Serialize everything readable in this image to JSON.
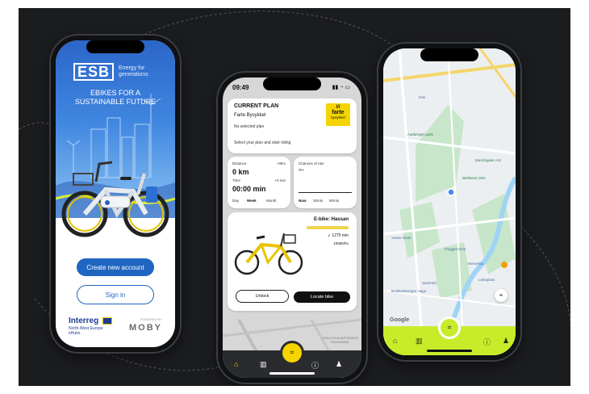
{
  "phone1": {
    "logo": "ESB",
    "logo_tagline": "Energy for generations",
    "headline_1": "EBIKES FOR A",
    "headline_2": "SUSTAINABLE FUTURE",
    "create_account_label": "Create new account",
    "sign_in_label": "Sign in",
    "partner_name": "Interreg",
    "partner_sub_1": "North-West Europe",
    "partner_sub_2": "eHubs",
    "powered_by": "POWERED BY",
    "powered_brand": "MOBY"
  },
  "phone2": {
    "status_time": "09:49",
    "plan_title": "CURRENT PLAN",
    "provider": "Farte Bysykkel",
    "no_plan": "No selected plan",
    "select_prompt": "Select your plan and start riding",
    "provider_logo_1": "farte",
    "provider_logo_2": "bysykkel",
    "distance_label": "Distance",
    "distance_delta": "+0km",
    "distance_value": "0 km",
    "time_label": "Time",
    "time_delta": "+0 min",
    "time_value": "00:00 min",
    "period_day": "Day",
    "period_week": "Week",
    "period_month": "Month",
    "rain_label": "Chances of rain",
    "rain_value": "0%",
    "rain_now": "Now",
    "rain_30": "30min",
    "rain_60": "60min",
    "bike_name": "E-bike: Hassan",
    "bike_range": "1275 min",
    "bike_id": "10586/hn",
    "unlock_label": "Unlock",
    "locate_label": "Locate bike",
    "map_label_1": "OSLO PHILANTHROPIC",
    "map_label_2": "EXCHANGE",
    "battery_level": 1.0
  },
  "phone3": {
    "places": {
      "kiwi": "Kiwi",
      "park": "Aasbergen park",
      "market": "Munchgaten AS",
      "wellness": "Wellness Oslo",
      "school": "Vestre skole",
      "flogget": "Flogget torve",
      "akerselva": "Akerselva",
      "samhold": "Samhold",
      "brokk": "Brokkelsbergen Hage",
      "lekfabrik": "Lekeplass"
    },
    "map_attribution": "Google"
  },
  "colors": {
    "esb_blue": "#1f66c1",
    "farte_yellow": "#f5d400",
    "accent_green": "#c9ec2a",
    "stage_bg": "#1b1c1e"
  },
  "icons": {
    "nav_home": "home-icon",
    "nav_map": "map-icon",
    "nav_scan": "qr-scan-icon",
    "nav_info": "info-icon",
    "nav_profile": "user-icon"
  }
}
